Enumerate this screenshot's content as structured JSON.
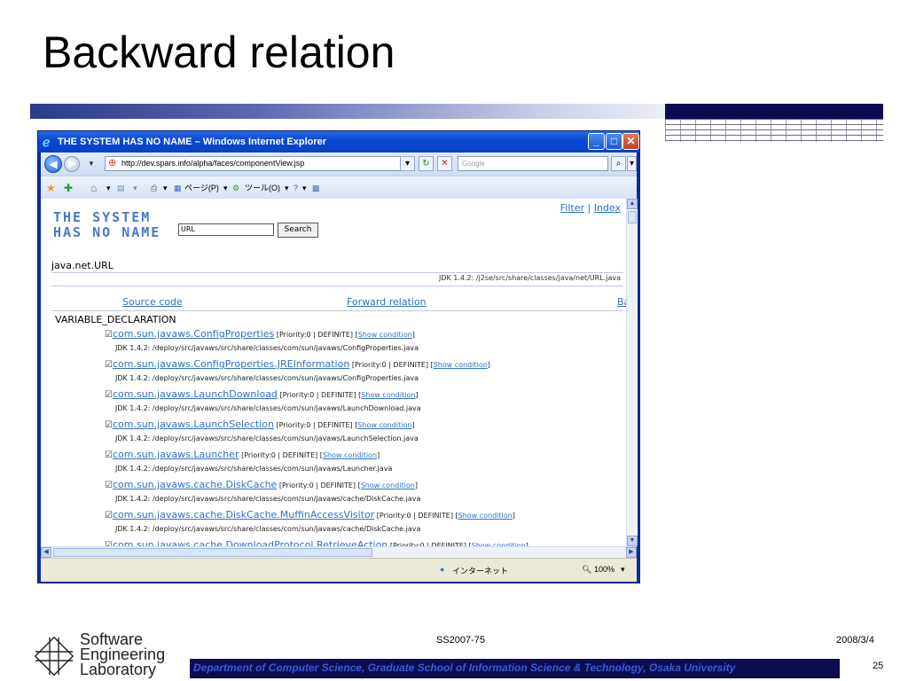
{
  "slide": {
    "title": "Backward relation",
    "footer_center": "SS2007-75",
    "footer_date": "2008/3/4",
    "footer_bar": "Department of Computer Science, Graduate School of Information Science & Technology, Osaka University",
    "page_number": "25",
    "logo_lines": [
      "Software",
      "Engineering",
      "Laboratory"
    ]
  },
  "browser": {
    "title": "THE SYSTEM HAS NO NAME – Windows Internet Explorer",
    "url": "http://dev.spars.info/alpha/faces/componentView.jsp",
    "search_placeholder": "Google",
    "cmd_page": "ページ(P)",
    "cmd_tools": "ツール(O)",
    "status_zone": "インターネット",
    "status_zoom": "100%"
  },
  "page": {
    "logo_line1": "THE SYSTEM",
    "logo_line2": "HAS NO NAME",
    "search_value": "URL",
    "search_button": "Search",
    "link_filter": "Filter",
    "link_index": "Index",
    "class_name": "java.net.URL",
    "class_path": "JDK 1.4.2: /j2se/src/share/classes/java/net/URL.java",
    "tab_source": "Source code",
    "tab_forward": "Forward relation",
    "tab_backward": "Ba",
    "decl_heading": "VARIABLE_DECLARATION",
    "entries": [
      {
        "cls": "com.sun.javaws.ConfigProperties",
        "meta": "[Priority:0 | DEFINITE] [",
        "cond": "Show condition",
        "close": "]",
        "path": "JDK 1.4.2: /deploy/src/javaws/src/share/classes/com/sun/javaws/ConfigProperties.java"
      },
      {
        "cls": "com.sun.javaws.ConfigProperties.JREInformation",
        "meta": "[Priority:0 | DEFINITE] [",
        "cond": "Show condition",
        "close": "]",
        "path": "JDK 1.4.2: /deploy/src/javaws/src/share/classes/com/sun/javaws/ConfigProperties.java"
      },
      {
        "cls": "com.sun.javaws.LaunchDownload",
        "meta": "[Priority:0 | DEFINITE] [",
        "cond": "Show condition",
        "close": "]",
        "path": "JDK 1.4.2: /deploy/src/javaws/src/share/classes/com/sun/javaws/LaunchDownload.java"
      },
      {
        "cls": "com.sun.javaws.LaunchSelection",
        "meta": "[Priority:0 | DEFINITE] [",
        "cond": "Show condition",
        "close": "]",
        "path": "JDK 1.4.2: /deploy/src/javaws/src/share/classes/com/sun/javaws/LaunchSelection.java"
      },
      {
        "cls": "com.sun.javaws.Launcher",
        "meta": "[Priority:0 | DEFINITE] [",
        "cond": "Show condition",
        "close": "]",
        "path": "JDK 1.4.2: /deploy/src/javaws/src/share/classes/com/sun/javaws/Launcher.java"
      },
      {
        "cls": "com.sun.javaws.cache.DiskCache",
        "meta": "[Priority:0 | DEFINITE] [",
        "cond": "Show condition",
        "close": "]",
        "path": "JDK 1.4.2: /deploy/src/javaws/src/share/classes/com/sun/javaws/cache/DiskCache.java"
      },
      {
        "cls": "com.sun.javaws.cache.DiskCache.MuffinAccessVisitor",
        "meta": "[Priority:0 | DEFINITE] [",
        "cond": "Show condition",
        "close": "]",
        "path": "JDK 1.4.2: /deploy/src/javaws/src/share/classes/com/sun/javaws/cache/DiskCache.java"
      },
      {
        "cls": "com.sun.javaws.cache.DownloadProtocol.RetrieveAction",
        "meta": "[Priority:0 | DEFINITE] [",
        "cond": "Show condition",
        "close": "]",
        "path": ""
      }
    ]
  }
}
